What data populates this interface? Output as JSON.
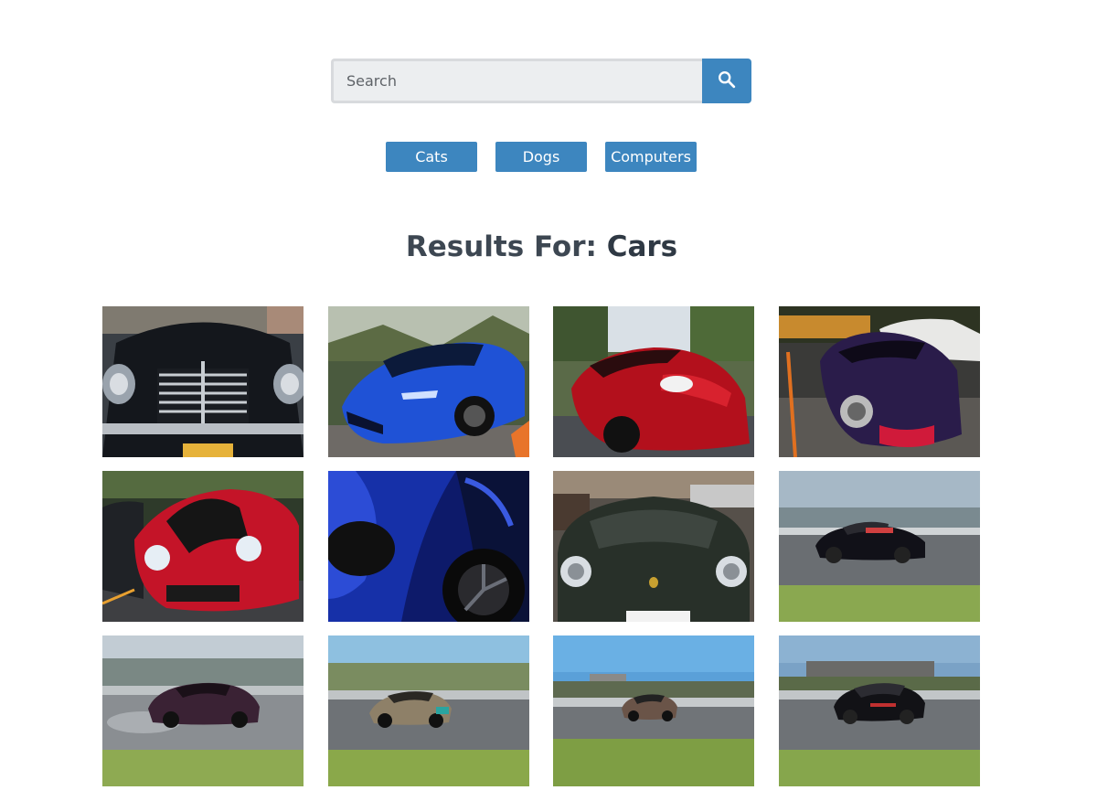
{
  "search": {
    "placeholder": "Search",
    "value": "",
    "button_icon": "search-icon"
  },
  "categories": [
    {
      "label": "Cats"
    },
    {
      "label": "Dogs"
    },
    {
      "label": "Computers"
    }
  ],
  "results": {
    "prefix": "Results For: ",
    "term": "Cars"
  },
  "colors": {
    "accent": "#3d86bf",
    "heading": "#3d4752",
    "input_bg": "#eceef0"
  },
  "images": [
    {
      "name": "vintage-black-car-grille"
    },
    {
      "name": "blue-mclaren-supercar"
    },
    {
      "name": "red-acura-nsx"
    },
    {
      "name": "purple-mazda-miata"
    },
    {
      "name": "red-porsche-gt2rs"
    },
    {
      "name": "blue-supercar-closeup"
    },
    {
      "name": "green-porsche-911"
    },
    {
      "name": "black-drift-car-track"
    },
    {
      "name": "purple-drift-car-track"
    },
    {
      "name": "tan-drift-car-track"
    },
    {
      "name": "bronze-nissan-z-track"
    },
    {
      "name": "black-drift-car-track-2"
    }
  ]
}
